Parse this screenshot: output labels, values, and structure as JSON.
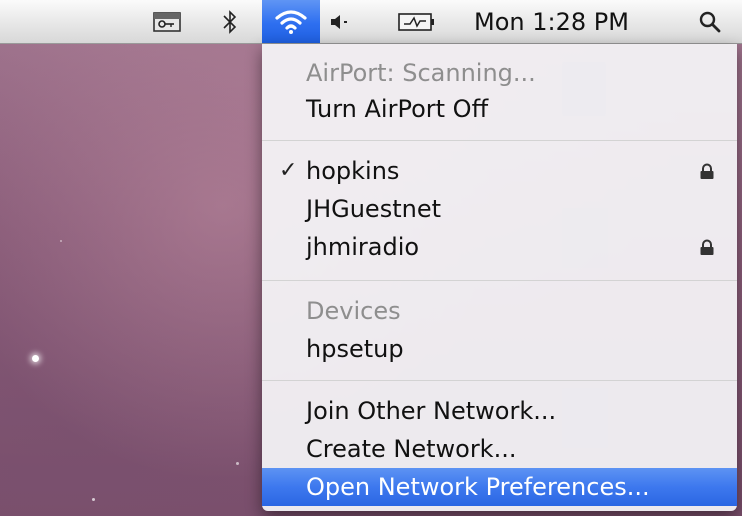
{
  "menubar": {
    "clock": "Mon 1:28 PM",
    "icons": {
      "keychain": "keychain-icon",
      "bluetooth": "bluetooth-icon",
      "wifi": "wifi-icon",
      "volume": "volume-icon",
      "battery": "battery-icon",
      "spotlight": "spotlight-search-icon"
    },
    "accent_color": "#3d78ee"
  },
  "airport_menu": {
    "status": "AirPort: Scanning...",
    "turn_off": "Turn AirPort Off",
    "networks": [
      {
        "name": "hopkins",
        "selected": true,
        "locked": true
      },
      {
        "name": "JHGuestnet",
        "selected": false,
        "locked": false
      },
      {
        "name": "jhmiradio",
        "selected": false,
        "locked": true
      }
    ],
    "devices_header": "Devices",
    "devices": [
      {
        "name": "hpsetup"
      }
    ],
    "join_other": "Join Other Network...",
    "create_network": "Create Network...",
    "open_prefs": "Open Network Preferences...",
    "check_glyph": "✓"
  }
}
